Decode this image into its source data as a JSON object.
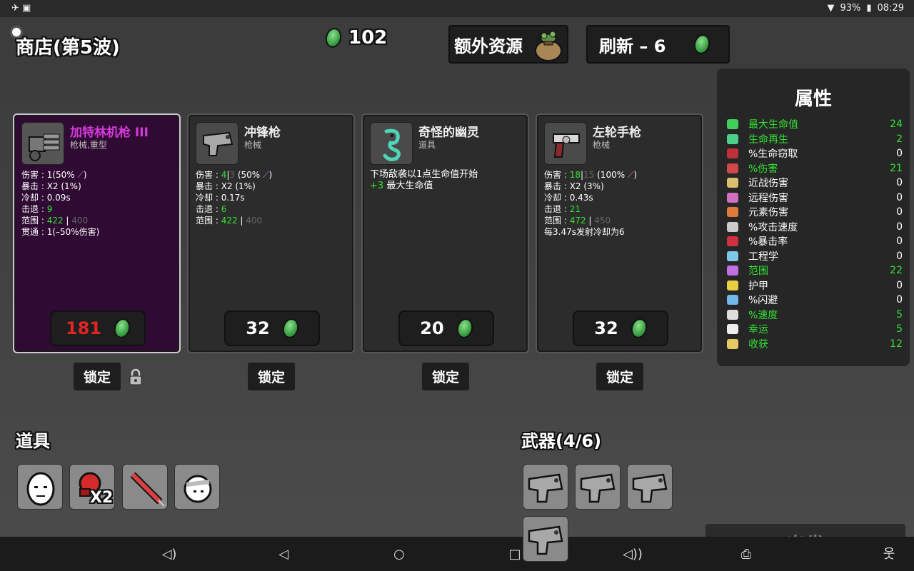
{
  "status": {
    "battery": "93%",
    "time": "08:29"
  },
  "header": {
    "shop_title": "商店(第5波)",
    "coins": "102",
    "extra_resources": "额外资源",
    "refresh": "刷新 – 6"
  },
  "cards": [
    {
      "name": "加特林机枪 III",
      "type": "枪械,重型",
      "price": "181",
      "stats": [
        {
          "label": "伤害",
          "value": "1(50%"
        },
        {
          "label": "暴击",
          "value": "X2 (1%)"
        },
        {
          "label": "冷却",
          "value": "0.09s"
        },
        {
          "label": "击退",
          "value": "9"
        },
        {
          "label": "范围",
          "value": "422",
          "extra": "400"
        },
        {
          "label": "贯通",
          "value": "1(–50%伤害)"
        }
      ]
    },
    {
      "name": "冲锋枪",
      "type": "枪械",
      "price": "32",
      "stats": [
        {
          "label": "伤害",
          "value": "4",
          "extra": "3",
          "suffix": "(50%"
        },
        {
          "label": "暴击",
          "value": "X2 (1%)"
        },
        {
          "label": "冷却",
          "value": "0.17s"
        },
        {
          "label": "击退",
          "value": "6"
        },
        {
          "label": "范围",
          "value": "422",
          "extra": "400"
        }
      ]
    },
    {
      "name": "奇怪的幽灵",
      "type": "道具",
      "price": "20",
      "desc1": "下场敌袭以1点生命值开始",
      "desc2_prefix": "+3",
      "desc2": "最大生命值"
    },
    {
      "name": "左轮手枪",
      "type": "枪械",
      "price": "32",
      "stats": [
        {
          "label": "伤害",
          "value": "18",
          "extra": "15",
          "suffix": "(100%"
        },
        {
          "label": "暴击",
          "value": "X2 (3%)"
        },
        {
          "label": "冷却",
          "value": "0.43s"
        },
        {
          "label": "击退",
          "value": "21"
        },
        {
          "label": "范围",
          "value": "472",
          "extra": "450"
        }
      ],
      "note": "每3.47s发射冷却为6"
    }
  ],
  "lock_label": "锁定",
  "stats_panel": {
    "title": "属性",
    "rows": [
      {
        "label": "最大生命值",
        "value": "24",
        "up": true,
        "color": "#3fcf5a"
      },
      {
        "label": "生命再生",
        "value": "2",
        "up": true,
        "color": "#4ccf8a"
      },
      {
        "label": "%生命窃取",
        "value": "0",
        "up": false,
        "color": "#c0303a"
      },
      {
        "label": "%伤害",
        "value": "21",
        "up": true,
        "color": "#d04848"
      },
      {
        "label": "近战伤害",
        "value": "0",
        "up": false,
        "color": "#d8c070"
      },
      {
        "label": "远程伤害",
        "value": "0",
        "up": false,
        "color": "#d070c0"
      },
      {
        "label": "元素伤害",
        "value": "0",
        "up": false,
        "color": "#e07a3a"
      },
      {
        "label": "%攻击速度",
        "value": "0",
        "up": false,
        "color": "#cccccc"
      },
      {
        "label": "%暴击率",
        "value": "0",
        "up": false,
        "color": "#d03040"
      },
      {
        "label": "工程学",
        "value": "0",
        "up": false,
        "color": "#80c8e8"
      },
      {
        "label": "范围",
        "value": "22",
        "up": true,
        "color": "#c070e0"
      },
      {
        "label": "护甲",
        "value": "0",
        "up": false,
        "color": "#e8d040"
      },
      {
        "label": "%闪避",
        "value": "0",
        "up": false,
        "color": "#70b8e8"
      },
      {
        "label": "%速度",
        "value": "5",
        "up": true,
        "color": "#dddddd"
      },
      {
        "label": "幸运",
        "value": "5",
        "up": true,
        "color": "#eeeeee"
      },
      {
        "label": "收获",
        "value": "12",
        "up": true,
        "color": "#e8c860"
      }
    ]
  },
  "items_title": "道具",
  "items_extra_label": "X2",
  "weapons_title": "武器(4/6)",
  "go_label": "出发"
}
